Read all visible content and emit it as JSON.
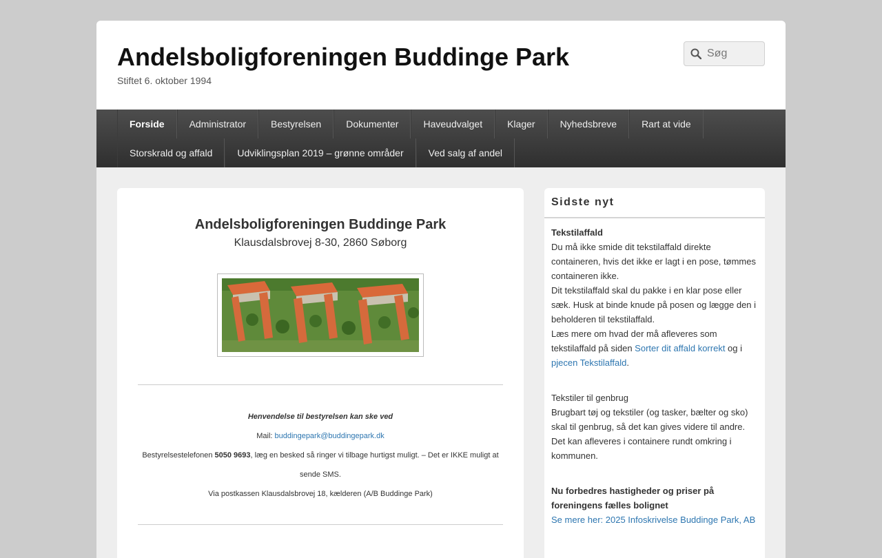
{
  "site": {
    "title": "Andelsboligforeningen Buddinge Park",
    "description": "Stiftet 6. oktober 1994"
  },
  "search": {
    "placeholder": "Søg"
  },
  "nav": {
    "row1": [
      "Forside",
      "Administrator",
      "Bestyrelsen",
      "Dokumenter",
      "Haveudvalget",
      "Klager",
      "Nyhedsbreve",
      "Rart at vide"
    ],
    "row2": [
      "Storskrald og affald",
      "Udviklingsplan 2019 – grønne områder",
      "Ved salg af andel"
    ]
  },
  "main": {
    "title": "Andelsboligforeningen Buddinge Park",
    "address": "Klausdalsbrovej 8-30, 2860 Søborg",
    "contact": {
      "heading": "Henvendelse til bestyrelsen kan ske ved",
      "mail_label": "Mail: ",
      "mail": "buddingepark@buddingepark.dk",
      "phone_pre": "Bestyrelsestelefonen ",
      "phone": "5050 9693",
      "phone_post": ", læg en besked så ringer vi tilbage hurtigst muligt. – Det er IKKE muligt at sende SMS.",
      "post": "Via postkassen Klausdalsbrovej 18, kælderen (A/B Buddinge Park)"
    }
  },
  "sidebar": {
    "title": "Sidste nyt",
    "news1": {
      "title": "Tekstilaffald",
      "p1": "Du må ikke smide dit  tekstilaffald direkte containeren, hvis det ikke er lagt i en pose, tømmes containeren ikke.",
      "p2": "Dit tekstilaffald skal du pakke i en klar pose eller sæk. Husk at binde knude på posen og lægge den i beholderen til tekstilaffald.",
      "p3_pre": "Læs mere om hvad der må afleveres som tekstilaffald på siden ",
      "link1": "Sorter dit affald korrekt",
      "p3_mid": " og i ",
      "link2": "pjecen Tekstilaffald",
      "p3_post": "."
    },
    "news2": {
      "title": "Tekstiler til genbrug",
      "body": "Brugbart tøj og tekstiler (og tasker, bælter og sko) skal til genbrug, så det kan gives videre til andre. Det kan afleveres i containere rundt omkring i kommunen."
    },
    "news3": {
      "title": "Nu forbedres hastigheder og priser på foreningens fælles bolignet",
      "link": "Se mere her: 2025 Infoskrivelse Buddinge Park, AB"
    }
  }
}
